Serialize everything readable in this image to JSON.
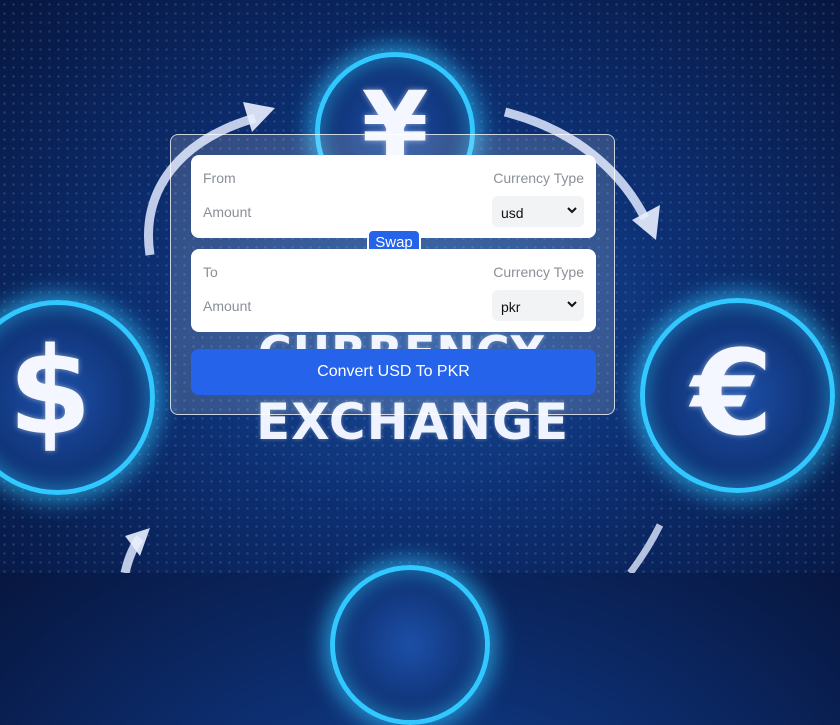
{
  "background": {
    "coins": {
      "yen": "¥",
      "dollar": "$",
      "euro": "€"
    },
    "words": {
      "line1": "CURRENCY",
      "line2": "EXCHANGE"
    }
  },
  "converter": {
    "from": {
      "label": "From",
      "currency_type_label": "Currency Type",
      "amount_label": "Amount",
      "selected_currency": "usd"
    },
    "swap_label": "Swap",
    "to": {
      "label": "To",
      "currency_type_label": "Currency Type",
      "amount_label": "Amount",
      "selected_currency": "pkr"
    },
    "convert_button_label": "Convert USD To PKR"
  },
  "colors": {
    "primary": "#2563eb",
    "glow": "#31c7ff"
  }
}
